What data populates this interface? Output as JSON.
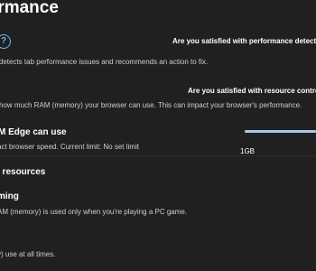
{
  "header": {
    "title": "rformance"
  },
  "performance_detector": {
    "help_icon": "question-circle-icon",
    "feedback": "Are you satisfied with performance detector?",
    "description": "r detects tab performance issues and recommends an action to fix."
  },
  "resource_controls": {
    "feedback": "Are you satisfied with resource controls?",
    "description": "how much RAM (memory) your browser can use. This can impact your browser's performance."
  },
  "ram_limit": {
    "title": "M Edge can use",
    "description": "act browser speed. Current limit: No set limit",
    "slider": {
      "min_label": "1GB",
      "level_percent": 100,
      "accent_color": "#a8c8ea"
    }
  },
  "resources": {
    "title": "l resources"
  },
  "gaming": {
    "title": "ming",
    "description": "AM (memory) is used only when you're playing a PC game."
  },
  "always": {
    "description": "y) use at all times."
  }
}
